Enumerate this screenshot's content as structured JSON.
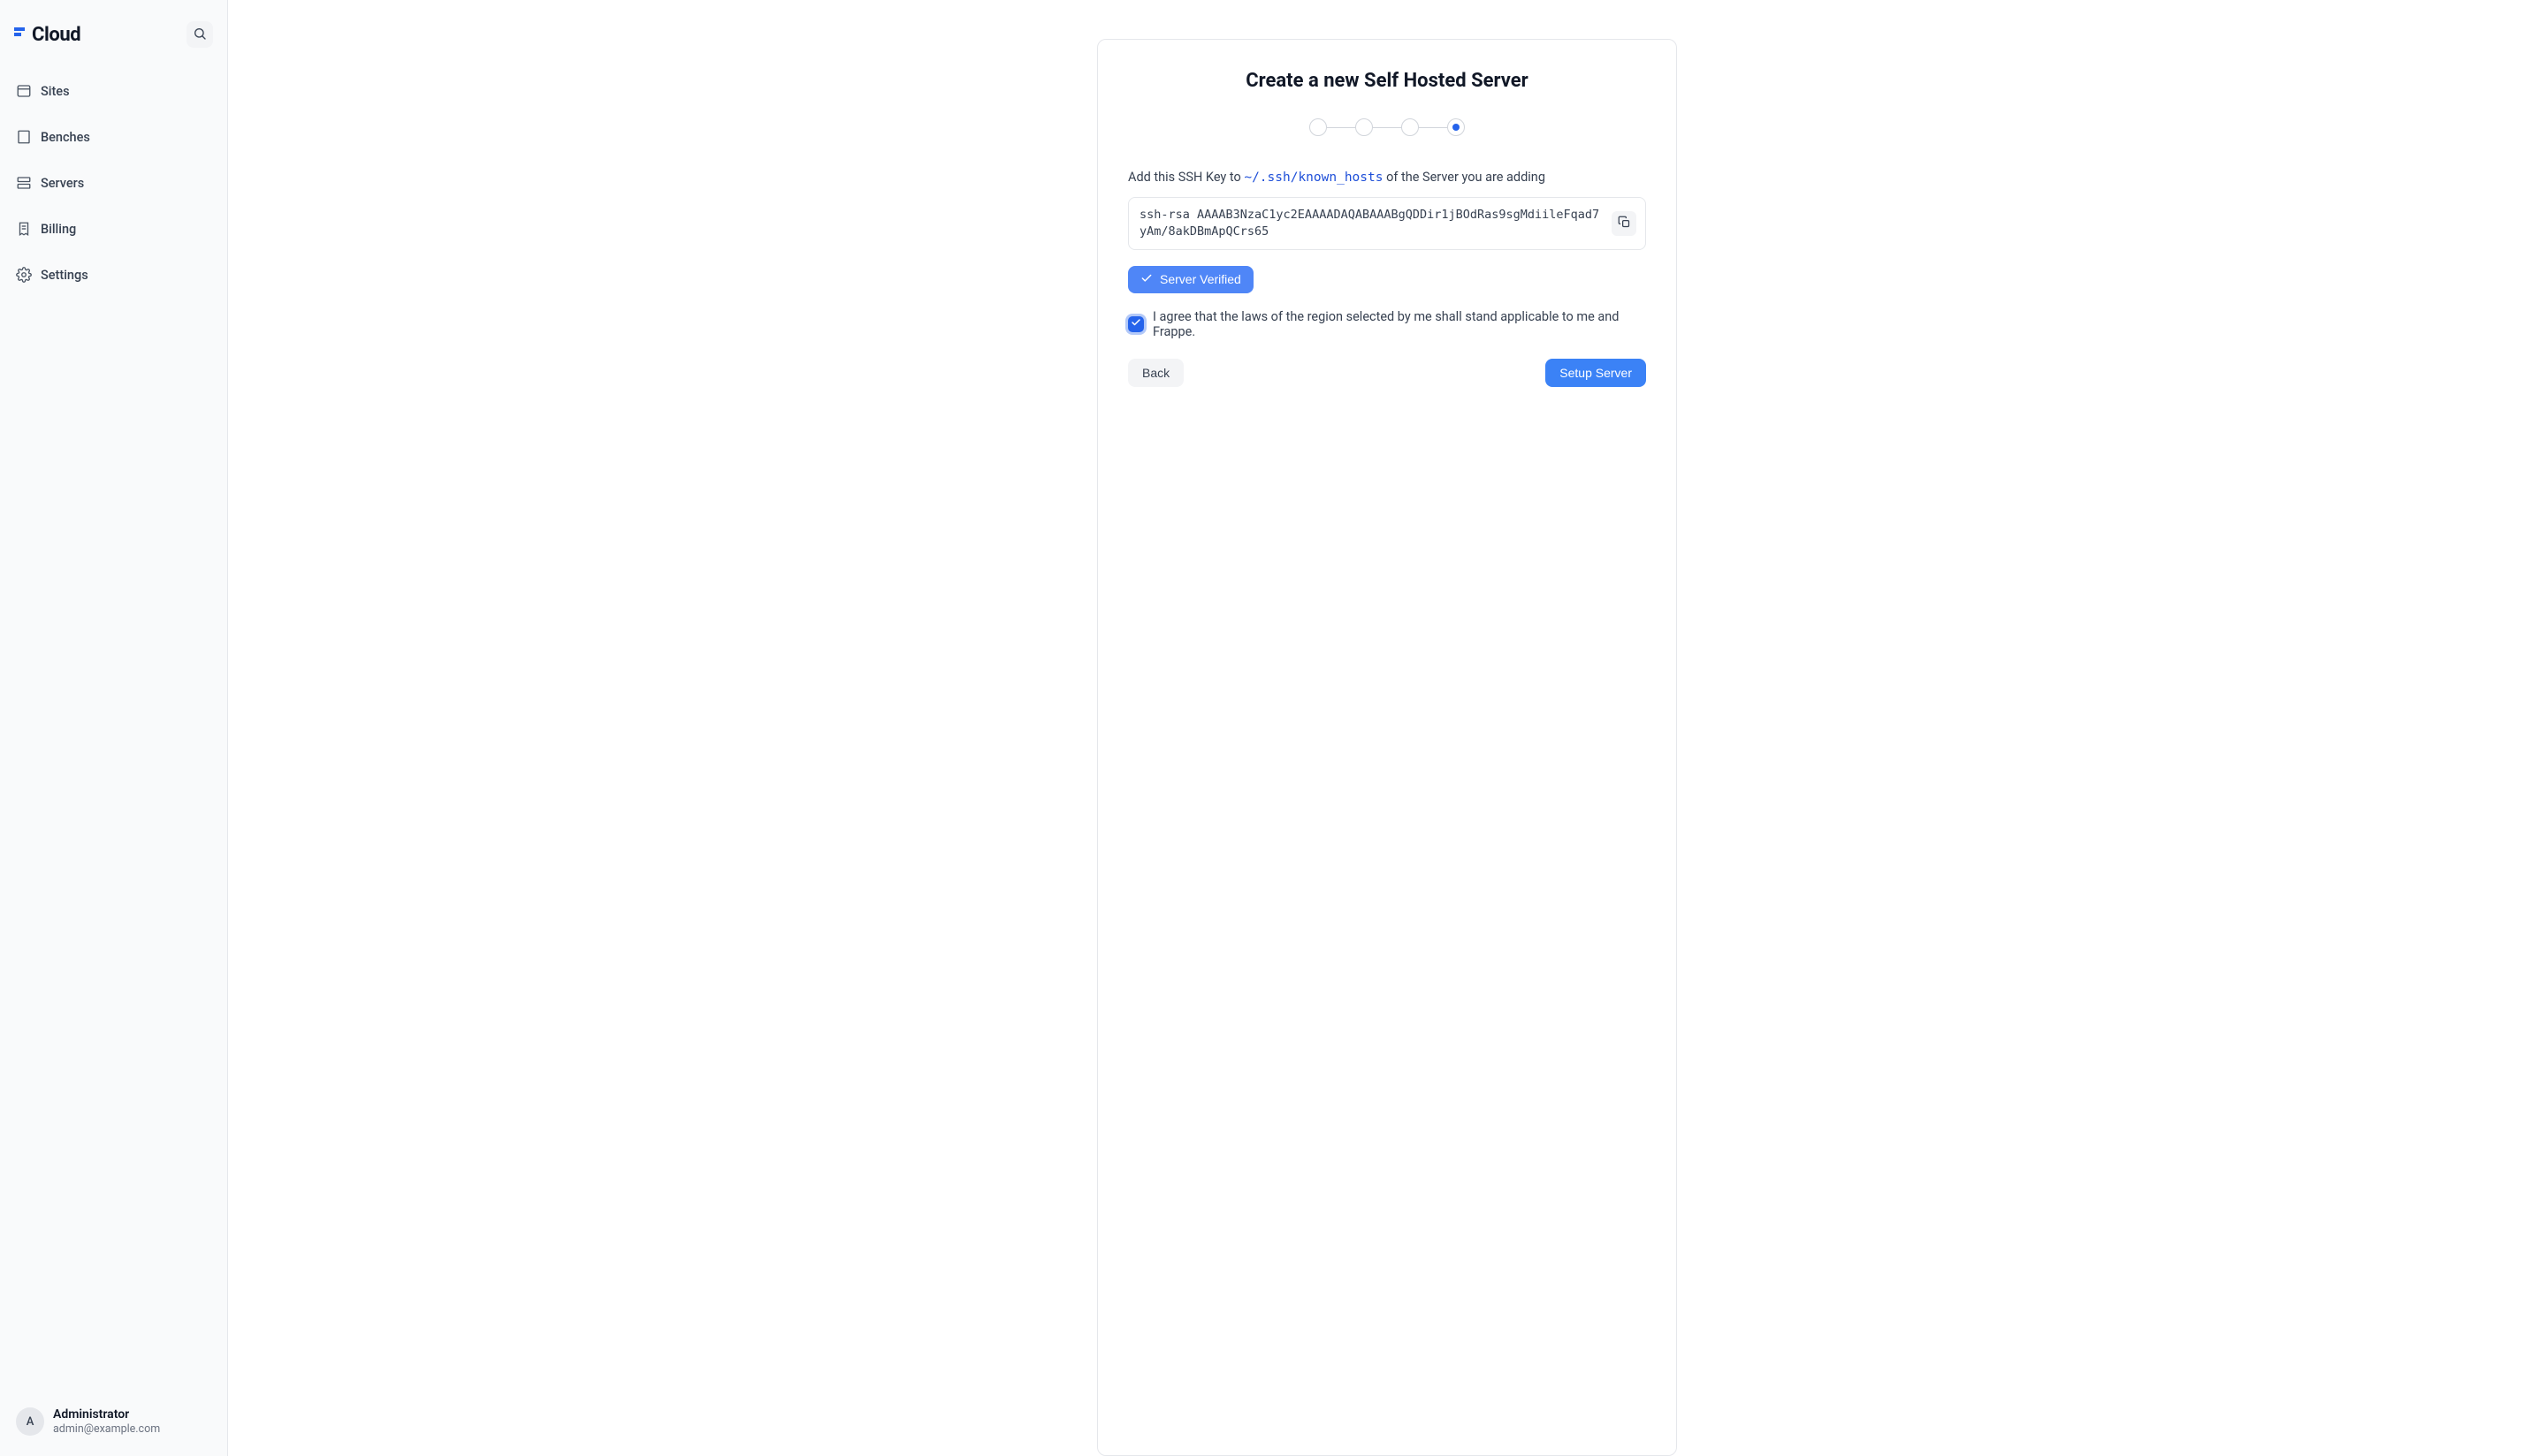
{
  "sidebar": {
    "brand": "Cloud",
    "nav": [
      {
        "label": "Sites",
        "icon": "browser-icon",
        "key": "sites"
      },
      {
        "label": "Benches",
        "icon": "building-icon",
        "key": "benches"
      },
      {
        "label": "Servers",
        "icon": "server-icon",
        "key": "servers"
      },
      {
        "label": "Billing",
        "icon": "receipt-icon",
        "key": "billing"
      },
      {
        "label": "Settings",
        "icon": "gear-icon",
        "key": "settings"
      }
    ],
    "user": {
      "initial": "A",
      "name": "Administrator",
      "email": "admin@example.com"
    }
  },
  "main": {
    "title": "Create a new Self Hosted Server",
    "current_step": 4,
    "total_steps": 4,
    "instruction_prefix": "Add this SSH Key to ",
    "instruction_path": "~/.ssh/known_hosts",
    "instruction_suffix": " of the Server you are adding",
    "ssh_key": "ssh-rsa AAAAB3NzaC1yc2EAAAADAQABAAABgQDDir1jBOdRas9sgMdiileFqad7yAm/8akDBmApQCrs65",
    "verified_label": "Server Verified",
    "agree_text": "I agree that the laws of the region selected by me shall stand applicable to me and Frappe.",
    "agree_checked": true,
    "back_label": "Back",
    "submit_label": "Setup Server"
  }
}
